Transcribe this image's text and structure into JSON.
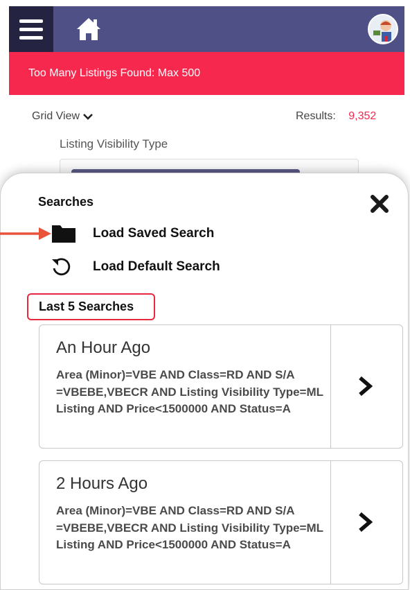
{
  "header": {
    "menu_icon": "hamburger-menu-icon",
    "home_icon": "home-icon",
    "avatar_icon": "user-avatar"
  },
  "alert": {
    "text": "Too Many Listings Found: Max 500"
  },
  "toolbar": {
    "view_label": "Grid View",
    "results_label": "Results:",
    "results_value": "9,352"
  },
  "filter": {
    "label": "Listing Visibility Type"
  },
  "sheet": {
    "title": "Searches",
    "close_icon": "close-icon",
    "items": [
      {
        "label": "Load Saved Search",
        "icon": "folder-icon"
      },
      {
        "label": "Load Default Search",
        "icon": "reset-icon"
      }
    ],
    "recent_heading": "Last 5 Searches",
    "recent": [
      {
        "time": "An Hour Ago",
        "query": "Area (Minor)=VBE AND Class=RD AND S/A =VBEBE,VBECR AND Listing Visibility Type=ML Listing AND Price<1500000 AND Status=A"
      },
      {
        "time": "2 Hours Ago",
        "query": "Area (Minor)=VBE AND Class=RD AND S/A =VBEBE,VBECR AND Listing Visibility Type=ML Listing AND Price<1500000 AND Status=A"
      }
    ]
  },
  "colors": {
    "header": "#4f5085",
    "menu_button": "#242442",
    "alert": "#f6284e",
    "highlight": "#e8293d"
  }
}
